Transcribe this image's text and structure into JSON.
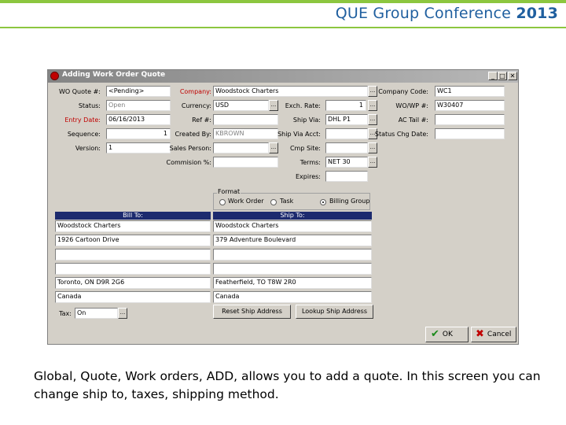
{
  "slide": {
    "conference_title": "QUE Group Conference",
    "conference_year": "2013",
    "caption": "Global, Quote, Work  orders, ADD, allows you to add a quote.   In this screen you can change ship to, taxes, shipping method."
  },
  "window": {
    "title": "Adding Work Order Quote",
    "min": "_",
    "max": "□",
    "close": "✕"
  },
  "form": {
    "wo_quote_label": "WO Quote #:",
    "wo_quote": "<Pending>",
    "status_label": "Status:",
    "status": "Open",
    "entry_date_label": "Entry Date:",
    "entry_date": "06/16/2013",
    "sequence_label": "Sequence:",
    "sequence": "1",
    "version_label": "Version:",
    "version": "1",
    "company_label": "Company:",
    "company": "Woodstock Charters",
    "currency_label": "Currency:",
    "currency": "USD",
    "exch_rate_label": "Exch. Rate:",
    "exch_rate": "1",
    "ref_label": "Ref #:",
    "ref": "",
    "ship_via_label": "Ship Via:",
    "ship_via": "DHL P1",
    "created_by_label": "Created By:",
    "created_by": "KBROWN",
    "ship_via_acct_label": "Ship Via Acct:",
    "ship_via_acct": "",
    "sales_person_label": "Sales Person:",
    "sales_person": "",
    "cmp_site_label": "Cmp Site:",
    "cmp_site": "",
    "commission_label": "Commision %:",
    "commission": "",
    "terms_label": "Terms:",
    "terms": "NET 30",
    "expires_label": "Expires:",
    "expires": "",
    "company_code_label": "Company Code:",
    "company_code": "WC1",
    "wo_wp_label": "WO/WP #:",
    "wo_wp": "W30407",
    "ac_tail_label": "AC Tail #:",
    "ac_tail": "",
    "status_chg_label": "Status Chg Date:",
    "status_chg": "",
    "dots": "..."
  },
  "format": {
    "label": "Format",
    "options": [
      "Work Order",
      "Task",
      "Billing Group"
    ],
    "selected": "Billing Group"
  },
  "bill_to": {
    "header": "Bill To:",
    "lines": [
      "Woodstock Charters",
      "1926 Cartoon Drive",
      "",
      "",
      "Toronto, ON D9R 2G6",
      "Canada"
    ]
  },
  "ship_to": {
    "header": "Ship To:",
    "lines": [
      "Woodstock Charters",
      "379 Adventure Boulevard",
      "",
      "",
      "Featherfield, TO T8W 2R0",
      "Canada"
    ]
  },
  "tax": {
    "label": "Tax:",
    "value": "On"
  },
  "buttons": {
    "reset_ship": "Reset Ship Address",
    "lookup_ship": "Lookup Ship Address",
    "ok": "OK",
    "cancel": "Cancel"
  }
}
